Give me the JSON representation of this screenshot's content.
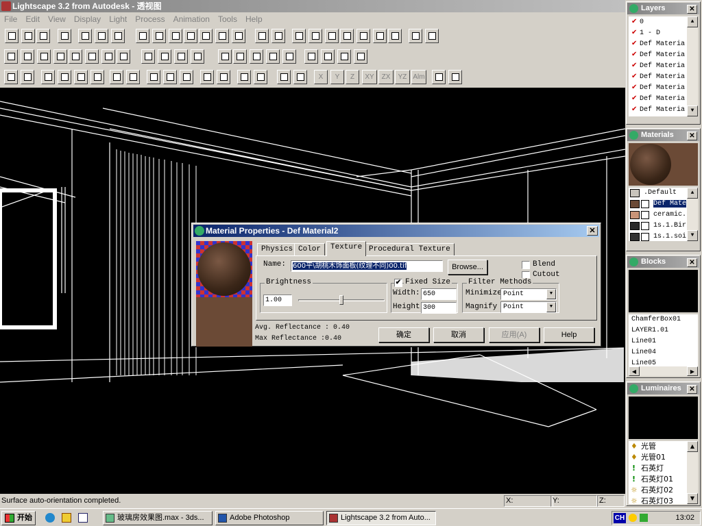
{
  "window": {
    "title": "Lightscape 3.2 from Autodesk - 透视图"
  },
  "menu": [
    "File",
    "Edit",
    "View",
    "Display",
    "Light",
    "Process",
    "Animation",
    "Tools",
    "Help"
  ],
  "status": {
    "message": "Surface auto-orientation completed.",
    "x_label": "X:",
    "y_label": "Y:",
    "z_label": "Z:"
  },
  "toolbar3": {
    "axis_buttons": [
      "X",
      "Y",
      "Z",
      "XY",
      "ZX",
      "YZ",
      "Alm"
    ]
  },
  "layers": {
    "title": "Layers",
    "items": [
      "0",
      "1 - D",
      "Def Materia",
      "Def Materia",
      "Def Materia",
      "Def Materia",
      "Def Materia",
      "Def Materia",
      "Def Materia"
    ]
  },
  "materials": {
    "title": "Materials",
    "items": [
      ".Default",
      "Def Mate",
      "ceramic.",
      "1s.1.Bir",
      "1s.1.soi"
    ],
    "colors": [
      "#c8c4bc",
      "#6b4a36",
      "#c89478",
      "#2a2a2a",
      "#333333"
    ]
  },
  "blocks": {
    "title": "Blocks",
    "items": [
      "ChamferBox01",
      "LAYER1.01",
      "Line01",
      "Line04",
      "Line05"
    ]
  },
  "luminaires": {
    "title": "Luminaires",
    "items": [
      "光管",
      "光管01",
      "石英灯",
      "石英灯01",
      "石英灯02",
      "石英灯03"
    ]
  },
  "dialog": {
    "title": "Material Properties - Def Material2",
    "tabs": [
      "Physics",
      "Color",
      "Texture",
      "Procedural Texture"
    ],
    "selected_tab": "Texture",
    "name_label": "Name:",
    "name_value": "600平\\胡桃木饰面板(纹理不同)00.tif",
    "browse": "Browse...",
    "blend": "Blend",
    "cutout": "Cutout",
    "brightness_label": "Brightness",
    "brightness_value": "1.00",
    "brightness_level": 0.5,
    "fixed_size": "Fixed Size",
    "fixed_checked": "✔",
    "width_label": "Width:",
    "width_value": "650",
    "height_label": "Height",
    "height_value": "300",
    "filter_label": "Filter Methods",
    "minimize_label": "Minimize",
    "minimize_value": "Point",
    "magnify_label": "Magnify",
    "magnify_value": "Point",
    "avg_reflectance": "Avg. Reflectance : 0.40",
    "max_reflectance": "Max Reflectance :0.40",
    "ok": "确定",
    "cancel": "取消",
    "apply": "应用(A)",
    "help": "Help"
  },
  "taskbar": {
    "start": "开始",
    "tasks": [
      "玻璃房效果图.max - 3ds...",
      "Adobe Photoshop",
      "Lightscape 3.2 from Auto..."
    ],
    "lang": "CH",
    "clock": "13:02"
  }
}
